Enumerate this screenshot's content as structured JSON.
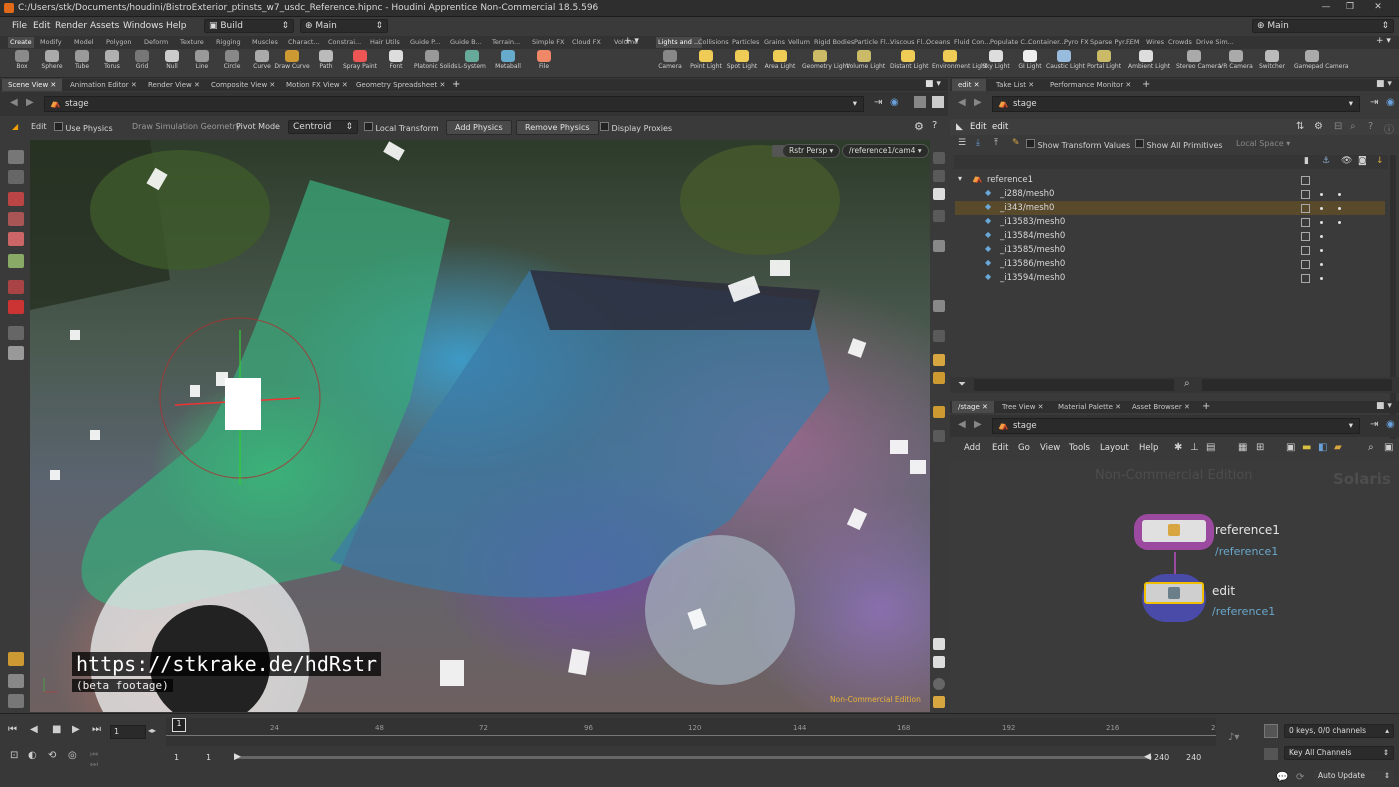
{
  "window": {
    "title": "C:/Users/stk/Documents/houdini/BistroExterior_ptinsts_w7_usdc_Reference.hipnc - Houdini Apprentice Non-Commercial 18.5.596"
  },
  "menu": {
    "items": [
      "File",
      "Edit",
      "Render",
      "Assets",
      "Windows",
      "Help"
    ],
    "desktop": "Build",
    "viewport_layout": "Main",
    "right_desktop": "Main"
  },
  "shelf_tabs_left": [
    "Create",
    "Modify",
    "Model",
    "Polygon",
    "Deform",
    "Texture",
    "Rigging",
    "Muscles",
    "Charact...",
    "Constrai...",
    "Hair Utils",
    "Guide P...",
    "Guide B...",
    "Terrain...",
    "Simple FX",
    "Cloud FX",
    "Volume"
  ],
  "shelf_tabs_right": [
    "Lights and ...",
    "Collisions",
    "Particles",
    "Grains",
    "Vellum",
    "Rigid Bodies",
    "Particle Fl...",
    "Viscous Fl...",
    "Oceans",
    "Fluid Con...",
    "Populate C...",
    "Container...",
    "Pyro FX",
    "Sparse Pyr...",
    "FEM",
    "Wires",
    "Crowds",
    "Drive Sim..."
  ],
  "tools_left": [
    "Box",
    "Sphere",
    "Tube",
    "Torus",
    "Grid",
    "Null",
    "Line",
    "Circle",
    "Curve",
    "Draw Curve",
    "Path",
    "Spray Paint",
    "Font",
    "Platonic Solids",
    "L-System",
    "Metaball",
    "File"
  ],
  "tools_right": [
    "Camera",
    "Point Light",
    "Spot Light",
    "Area Light",
    "Geometry Light",
    "Volume Light",
    "Distant Light",
    "Environment Light",
    "Sky Light",
    "GI Light",
    "Caustic Light",
    "Portal Light",
    "Ambient Light",
    "Stereo Camera",
    "VR Camera",
    "Switcher",
    "Gamepad Camera"
  ],
  "pane_tabs": [
    "Scene View",
    "Animation Editor",
    "Render View",
    "Composite View",
    "Motion FX View",
    "Geometry Spreadsheet"
  ],
  "path": {
    "node": "stage"
  },
  "opbar": {
    "edit": "Edit",
    "use_physics": "Use Physics",
    "draw_sim": "Draw Simulation Geometry",
    "pivot_mode_label": "Pivot Mode",
    "pivot_mode": "Centroid",
    "local_transform": "Local Transform",
    "add_physics": "Add Physics",
    "remove_physics": "Remove Physics",
    "display_proxies": "Display Proxies"
  },
  "viewport": {
    "persp": "Rstr Persp",
    "camera": "/reference1/cam4",
    "watermark": "Non-Commercial Edition",
    "overlay_url": "https://stkrake.de/hdRstr",
    "overlay_sub": "(beta footage)"
  },
  "scenegraph": {
    "tabs": [
      "edit",
      "Take List",
      "Performance Monitor"
    ],
    "path": "stage",
    "edit_label": "Edit",
    "edit_value": "edit",
    "show_transform_values": "Show Transform Values",
    "show_all_primitives": "Show All Primitives",
    "local_space": "Local Space",
    "rows": [
      {
        "name": "reference1",
        "indent": 0,
        "sel": false,
        "dots": 0
      },
      {
        "name": "_i288/mesh0",
        "indent": 1,
        "sel": false,
        "dots": 2
      },
      {
        "name": "_i343/mesh0",
        "indent": 1,
        "sel": true,
        "dots": 2
      },
      {
        "name": "_i13583/mesh0",
        "indent": 1,
        "sel": false,
        "dots": 2
      },
      {
        "name": "_i13584/mesh0",
        "indent": 1,
        "sel": false,
        "dots": 1
      },
      {
        "name": "_i13585/mesh0",
        "indent": 1,
        "sel": false,
        "dots": 1
      },
      {
        "name": "_i13586/mesh0",
        "indent": 1,
        "sel": false,
        "dots": 1
      },
      {
        "name": "_i13594/mesh0",
        "indent": 1,
        "sel": false,
        "dots": 1
      }
    ]
  },
  "network": {
    "tabs": [
      "/stage",
      "Tree View",
      "Material Palette",
      "Asset Browser"
    ],
    "path": "stage",
    "menu": [
      "Add",
      "Edit",
      "Go",
      "View",
      "Tools",
      "Layout",
      "Help"
    ],
    "watermark": "Non-Commercial Edition",
    "context": "Solaris",
    "nodes": [
      {
        "name": "reference1",
        "sub": "/reference1"
      },
      {
        "name": "edit",
        "sub": "/reference1"
      }
    ]
  },
  "timeline": {
    "ticks": [
      "24",
      "48",
      "72",
      "96",
      "120",
      "144",
      "168",
      "192",
      "216",
      "2"
    ],
    "current_frame": "1",
    "frame_box": "1",
    "start": "1",
    "start2": "1",
    "end": "240",
    "end2": "240",
    "keys": "0 keys, 0/0 channels",
    "key_all": "Key All Channels",
    "auto_update": "Auto Update"
  },
  "colors": {
    "accent": "#f0a000",
    "selected_row": "#5a4a2c",
    "node_border": "#9c4aa0"
  }
}
